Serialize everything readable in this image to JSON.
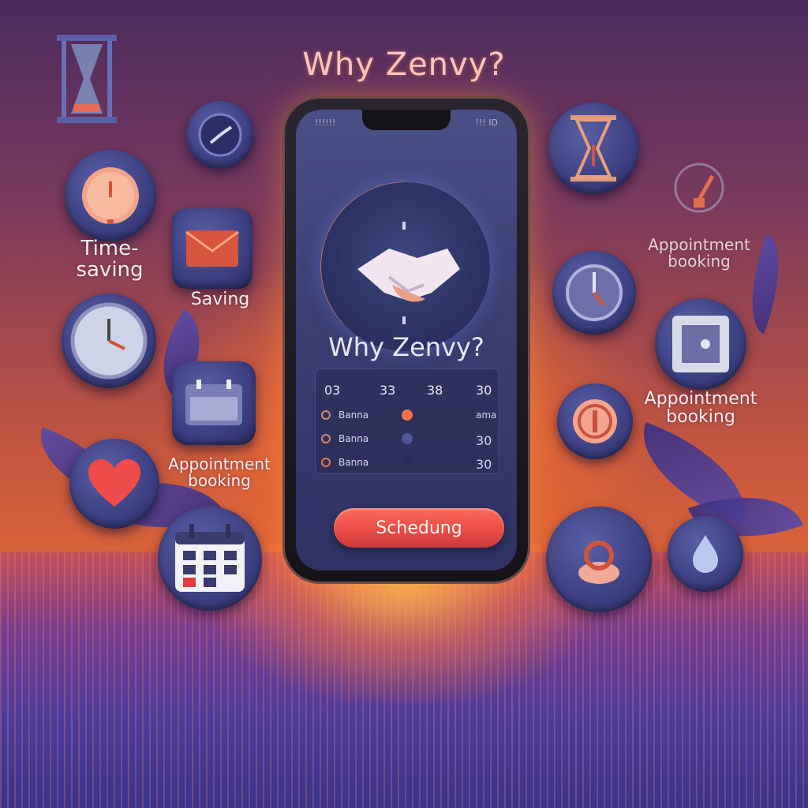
{
  "heading": "Why Zenvy?",
  "labels": {
    "time_saving": "Time-\nsaving",
    "saving": "Saving",
    "appointment_left": "Appointment\nbooking",
    "appointment_right_top": "Appointment\nbooking",
    "appointment_right_mid": "Appointment\nbooking"
  },
  "phone": {
    "status_left": "!!!!!!",
    "status_right": "!!! ID",
    "title": "Why Zenvy?",
    "table": {
      "header": [
        "03",
        "33",
        "38",
        "30"
      ],
      "rows": [
        {
          "label": "Banna",
          "value": "ama"
        },
        {
          "label": "Banna",
          "value": "30"
        },
        {
          "label": "Banna",
          "value": "30"
        }
      ]
    },
    "button_label": "Schedung"
  },
  "colors": {
    "accent": "#e84a45",
    "bubble": "#3c3f80",
    "glow": "#ffaa3c"
  },
  "icons": [
    "hourglass-icon",
    "clock-icon",
    "calendar-icon",
    "heart-icon",
    "handshake-icon",
    "stopwatch-icon"
  ]
}
